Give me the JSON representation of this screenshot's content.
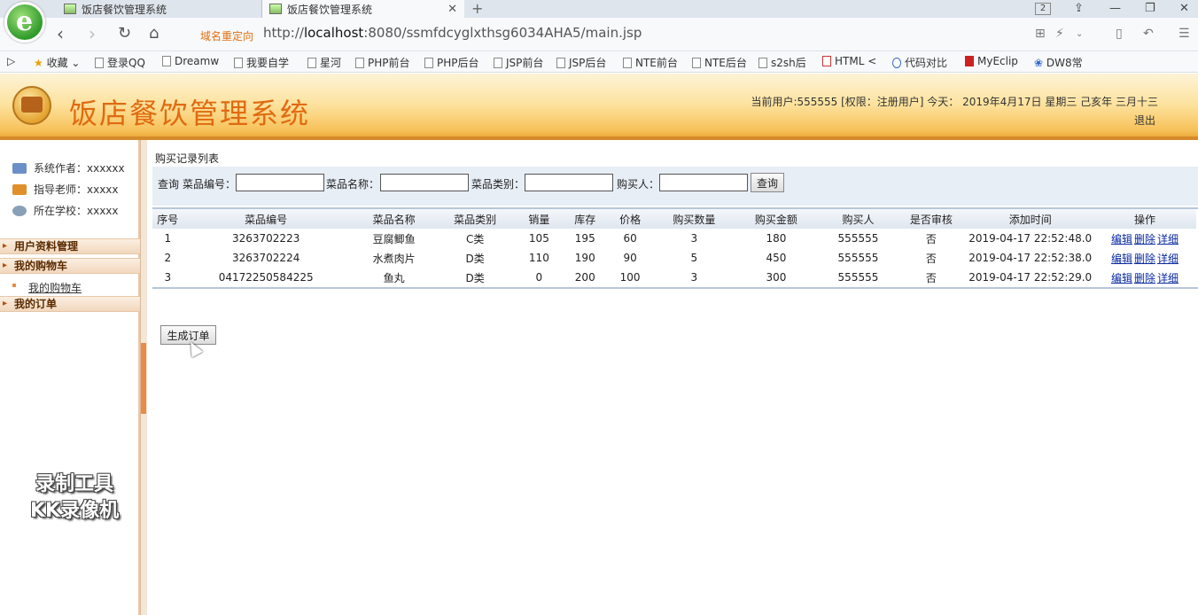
{
  "browser": {
    "tabs": [
      {
        "title": "饭店餐饮管理系统"
      },
      {
        "title": "饭店餐饮管理系统"
      }
    ],
    "tab_count": "2",
    "redirect_label": "域名重定向",
    "url_prefix": "http://",
    "url_host": "localhost",
    "url_rest": ":8080/ssmfdcyglxthsg6034AHA5/main.jsp",
    "bookmarks": [
      "收藏",
      "登录QQ",
      "Dreamw",
      "我要自学",
      "星河",
      "PHP前台",
      "PHP后台",
      "JSP前台",
      "JSP后台",
      "NTE前台",
      "NTE后台",
      "s2sh后",
      "HTML <",
      "代码对比",
      "MyEclip",
      "DW8常"
    ]
  },
  "header": {
    "title": "饭店餐饮管理系统",
    "user_info": "当前用户:555555 [权限：注册用户] 今天： 2019年4月17日 星期三 己亥年 三月十三",
    "logout": "退出"
  },
  "sidebar": {
    "info": [
      {
        "label": "系统作者：xxxxxx",
        "color": "#6c8fc7"
      },
      {
        "label": "指导老师：xxxxx",
        "color": "#e0902a"
      },
      {
        "label": "所在学校：xxxxx",
        "color": "#8aa0b8"
      }
    ],
    "menus": [
      {
        "label": "用户资料管理"
      },
      {
        "label": "我的购物车"
      },
      {
        "label": "我的订单"
      }
    ],
    "submenu": "我的购物车",
    "watermark": [
      "录制工具",
      "KK录像机"
    ]
  },
  "main": {
    "list_title": "购买记录列表",
    "search": {
      "prefix": "查询",
      "fields": [
        "菜品编号：",
        "菜品名称：",
        "菜品类别：",
        "购买人："
      ],
      "button": "查询"
    },
    "columns": [
      "序号",
      "菜品编号",
      "菜品名称",
      "菜品类别",
      "销量",
      "库存",
      "价格",
      "购买数量",
      "购买金额",
      "购买人",
      "是否审核",
      "添加时间",
      "操作"
    ],
    "rows": [
      [
        "1",
        "3263702223",
        "豆腐鲫鱼",
        "C类",
        "105",
        "195",
        "60",
        "3",
        "180",
        "555555",
        "否",
        "2019-04-17 22:52:48.0"
      ],
      [
        "2",
        "3263702224",
        "水煮肉片",
        "D类",
        "110",
        "190",
        "90",
        "5",
        "450",
        "555555",
        "否",
        "2019-04-17 22:52:38.0"
      ],
      [
        "3",
        "04172250584225",
        "鱼丸",
        "D类",
        "0",
        "200",
        "100",
        "3",
        "300",
        "555555",
        "否",
        "2019-04-17 22:52:29.0"
      ]
    ],
    "actions": [
      "编辑",
      "删除",
      "详细"
    ],
    "order_button": "生成订单"
  }
}
